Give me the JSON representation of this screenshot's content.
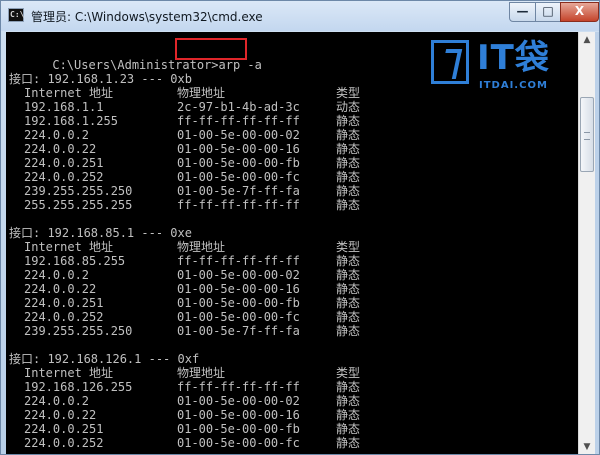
{
  "window": {
    "title": "管理员: C:\\Windows\\system32\\cmd.exe",
    "icon": "C:\\",
    "minimize_glyph": "—",
    "maximize_glyph": "□",
    "close_glyph": "X"
  },
  "logo": {
    "brand": "IT袋",
    "sub": "ITDAI.COM"
  },
  "console": {
    "prompt": "C:\\Users\\Administrator>",
    "command": "arp -a",
    "columns": {
      "internet": "Internet 地址",
      "physical": "物理地址",
      "type": "类型"
    },
    "interfaces": [
      {
        "header": "接口: 192.168.1.23 --- 0xb",
        "entries": [
          {
            "ip": "192.168.1.1",
            "mac": "2c-97-b1-4b-ad-3c",
            "type": "动态"
          },
          {
            "ip": "192.168.1.255",
            "mac": "ff-ff-ff-ff-ff-ff",
            "type": "静态"
          },
          {
            "ip": "224.0.0.2",
            "mac": "01-00-5e-00-00-02",
            "type": "静态"
          },
          {
            "ip": "224.0.0.22",
            "mac": "01-00-5e-00-00-16",
            "type": "静态"
          },
          {
            "ip": "224.0.0.251",
            "mac": "01-00-5e-00-00-fb",
            "type": "静态"
          },
          {
            "ip": "224.0.0.252",
            "mac": "01-00-5e-00-00-fc",
            "type": "静态"
          },
          {
            "ip": "239.255.255.250",
            "mac": "01-00-5e-7f-ff-fa",
            "type": "静态"
          },
          {
            "ip": "255.255.255.255",
            "mac": "ff-ff-ff-ff-ff-ff",
            "type": "静态"
          }
        ]
      },
      {
        "header": "接口: 192.168.85.1 --- 0xe",
        "entries": [
          {
            "ip": "192.168.85.255",
            "mac": "ff-ff-ff-ff-ff-ff",
            "type": "静态"
          },
          {
            "ip": "224.0.0.2",
            "mac": "01-00-5e-00-00-02",
            "type": "静态"
          },
          {
            "ip": "224.0.0.22",
            "mac": "01-00-5e-00-00-16",
            "type": "静态"
          },
          {
            "ip": "224.0.0.251",
            "mac": "01-00-5e-00-00-fb",
            "type": "静态"
          },
          {
            "ip": "224.0.0.252",
            "mac": "01-00-5e-00-00-fc",
            "type": "静态"
          },
          {
            "ip": "239.255.255.250",
            "mac": "01-00-5e-7f-ff-fa",
            "type": "静态"
          }
        ]
      },
      {
        "header": "接口: 192.168.126.1 --- 0xf",
        "entries": [
          {
            "ip": "192.168.126.255",
            "mac": "ff-ff-ff-ff-ff-ff",
            "type": "静态"
          },
          {
            "ip": "224.0.0.2",
            "mac": "01-00-5e-00-00-02",
            "type": "静态"
          },
          {
            "ip": "224.0.0.22",
            "mac": "01-00-5e-00-00-16",
            "type": "静态"
          },
          {
            "ip": "224.0.0.251",
            "mac": "01-00-5e-00-00-fb",
            "type": "静态"
          },
          {
            "ip": "224.0.0.252",
            "mac": "01-00-5e-00-00-fc",
            "type": "静态"
          }
        ]
      }
    ]
  },
  "scrollbar": {
    "up_glyph": "▲",
    "down_glyph": "▼"
  }
}
